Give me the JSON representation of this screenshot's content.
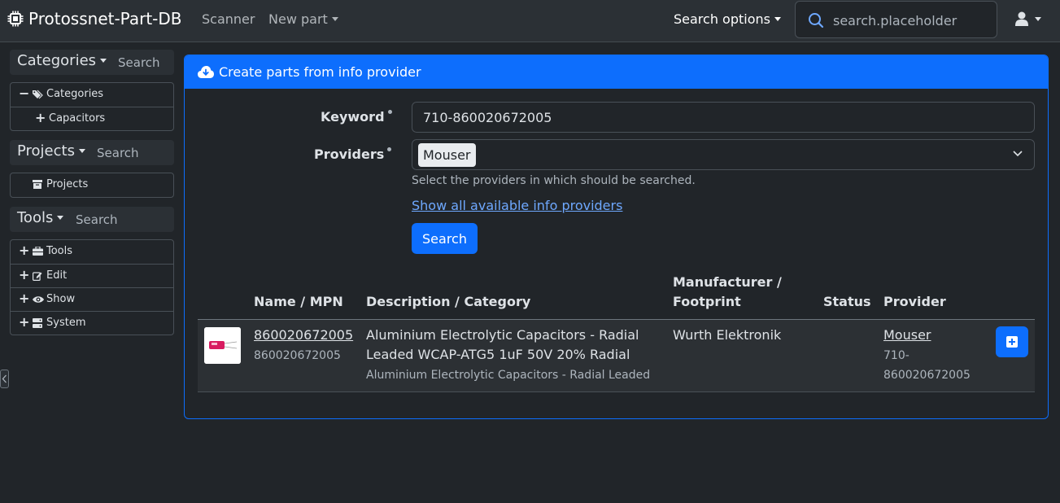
{
  "navbar": {
    "brand": "Protossnet-Part-DB",
    "scanner": "Scanner",
    "new_part": "New part",
    "search_options": "Search options",
    "search_placeholder": "search.placeholder"
  },
  "sidebar": {
    "categories": {
      "title": "Categories",
      "search": "Search",
      "items": [
        "Categories",
        "Capacitors"
      ]
    },
    "projects": {
      "title": "Projects",
      "search": "Search",
      "items": [
        "Projects"
      ]
    },
    "tools": {
      "title": "Tools",
      "search": "Search",
      "items": [
        "Tools",
        "Edit",
        "Show",
        "System"
      ]
    }
  },
  "card": {
    "title": "Create parts from info provider",
    "keyword_label": "Keyword",
    "keyword_value": "710-860020672005",
    "providers_label": "Providers",
    "provider_selected": "Mouser",
    "providers_help": "Select the providers in which should be searched.",
    "show_providers_link": "Show all available info providers",
    "search_button": "Search"
  },
  "table": {
    "headers": {
      "name": "Name / MPN",
      "description": "Description / Category",
      "manufacturer_1": "Manufacturer /",
      "manufacturer_2": "Footprint",
      "status": "Status",
      "provider": "Provider"
    },
    "rows": [
      {
        "name": "860020672005",
        "mpn": "860020672005",
        "description_1": "Aluminium Electrolytic Capacitors - Radial",
        "description_2": "Leaded WCAP-ATG5 1uF 50V 20% Radial",
        "category": "Aluminium Electrolytic Capacitors - Radial Leaded",
        "manufacturer": "Wurth Elektronik",
        "status": "",
        "provider": "Mouser",
        "provider_id_1": "710-",
        "provider_id_2": "860020672005"
      }
    ]
  },
  "colors": {
    "primary": "#0d6efd",
    "background": "#212529",
    "navbar": "#2b3035",
    "link": "#6ea8fe"
  }
}
